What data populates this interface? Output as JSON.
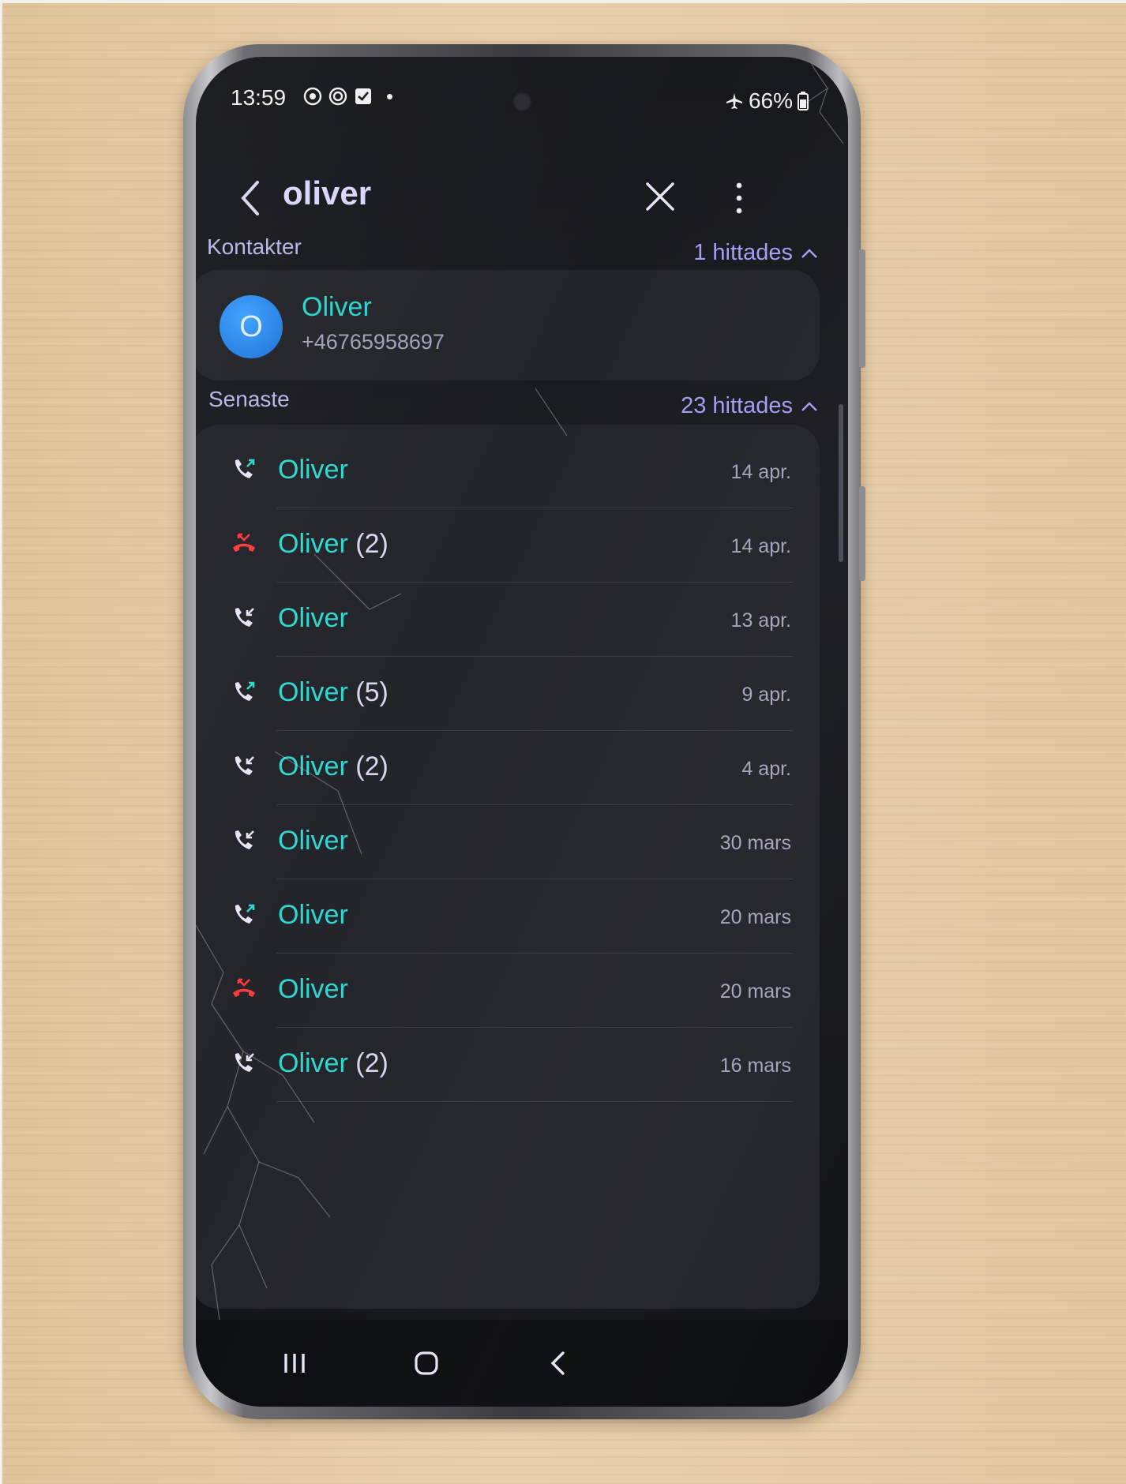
{
  "status_bar": {
    "time": "13:59",
    "battery": "66%"
  },
  "header": {
    "query": "oliver"
  },
  "contacts_section": {
    "title": "Kontakter",
    "count": "1 hittades",
    "contact": {
      "initial": "O",
      "name": "Oliver",
      "number": "+46765958697"
    }
  },
  "recent_section": {
    "title": "Senaste",
    "count": "23 hittades",
    "calls": [
      {
        "name": "Oliver",
        "count": "",
        "date": "14 apr.",
        "type": "outgoing"
      },
      {
        "name": "Oliver",
        "count": "(2)",
        "date": "14 apr.",
        "type": "missed"
      },
      {
        "name": "Oliver",
        "count": "",
        "date": "13 apr.",
        "type": "incoming"
      },
      {
        "name": "Oliver",
        "count": "(5)",
        "date": "9 apr.",
        "type": "outgoing"
      },
      {
        "name": "Oliver",
        "count": "(2)",
        "date": "4 apr.",
        "type": "incoming"
      },
      {
        "name": "Oliver",
        "count": "",
        "date": "30 mars",
        "type": "incoming"
      },
      {
        "name": "Oliver",
        "count": "",
        "date": "20 mars",
        "type": "outgoing"
      },
      {
        "name": "Oliver",
        "count": "",
        "date": "20 mars",
        "type": "missed"
      },
      {
        "name": "Oliver",
        "count": "(2)",
        "date": "16 mars",
        "type": "incoming"
      }
    ]
  },
  "colors": {
    "accent_name": "#2ed8d0",
    "accent_header": "#a79cf2",
    "missed": "#ff3b3b",
    "card": "#24252b"
  },
  "icons": {
    "back": "chevron-left-icon",
    "clear": "close-icon",
    "more": "more-vert-icon",
    "outgoing": "call-outgoing-icon",
    "incoming": "call-incoming-icon",
    "missed": "call-missed-icon"
  }
}
